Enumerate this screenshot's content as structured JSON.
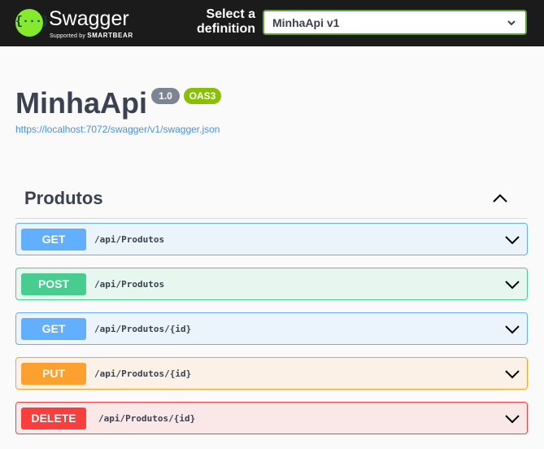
{
  "topbar": {
    "logo_glyph": "{···}",
    "logo_word": "Swagger",
    "logo_sub_prefix": "Supported by",
    "logo_sub_brand": "SMARTBEAR",
    "select_label": "Select a definition",
    "select_value": "MinhaApi v1"
  },
  "info": {
    "title": "MinhaApi",
    "version": "1.0",
    "oas": "OAS3",
    "spec_url": "https://localhost:7072/swagger/v1/swagger.json"
  },
  "tag": {
    "name": "Produtos",
    "expanded": true
  },
  "operations": [
    {
      "method": "GET",
      "path": "/api/Produtos"
    },
    {
      "method": "POST",
      "path": "/api/Produtos"
    },
    {
      "method": "GET",
      "path": "/api/Produtos/{id}"
    },
    {
      "method": "PUT",
      "path": "/api/Produtos/{id}"
    },
    {
      "method": "DELETE",
      "path": "/api/Produtos/{id}"
    }
  ],
  "colors": {
    "topbar_bg": "#1b1b1b",
    "logo_green": "#85ea2d",
    "get": "#61affe",
    "post": "#49cc90",
    "put": "#fca130",
    "delete": "#f93e3e",
    "version_badge": "#7d8492",
    "oas_badge": "#89bf04",
    "link": "#4990e2"
  }
}
